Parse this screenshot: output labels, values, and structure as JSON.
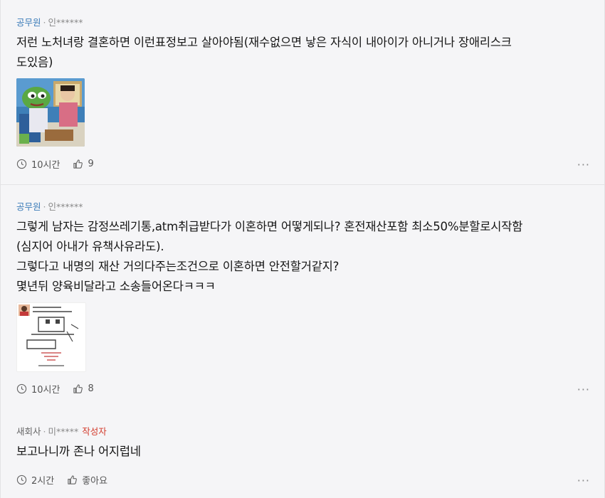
{
  "comments": [
    {
      "company": "공무원",
      "user": "인******",
      "text_lines": [
        "저런 노처녀랑 결혼하면 이런표정보고 살아야됨(재수없으면 낳은 자식이 내아이가 아니거나 장애리스크",
        "도있음)"
      ],
      "time": "10시간",
      "likes": "9"
    },
    {
      "company": "공무원",
      "user": "인******",
      "text_lines": [
        "그렇게 남자는 감정쓰레기통,atm취급받다가 이혼하면 어떻게되나? 혼전재산포함 최소50%분할로시작함",
        "(심지어 아내가 유책사유라도).",
        "그렇다고 내명의 재산 거의다주는조건으로 이혼하면 안전할거같지?",
        "몇년뒤 양육비달라고 소송들어온다ㅋㅋㅋ"
      ],
      "time": "10시간",
      "likes": "8"
    },
    {
      "company": "새회사",
      "user": "미*****",
      "author_badge": "작성자",
      "text_lines": [
        "보고나니까 존나 어지럽네"
      ],
      "time": "2시간",
      "likes": "좋아요"
    }
  ],
  "more_label": "···",
  "dot": "·"
}
